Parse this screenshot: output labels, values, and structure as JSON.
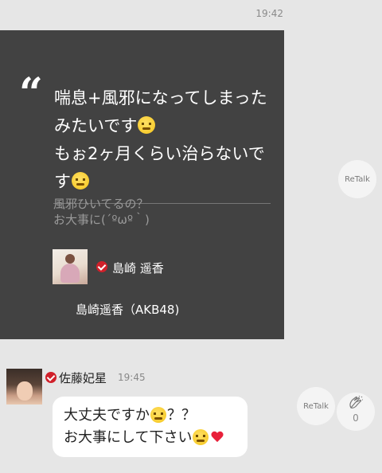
{
  "header": {
    "time": "19:42"
  },
  "quote_card": {
    "quote_mark": "“",
    "text_segments": [
      "喘息+風邪になってしまったみたいです",
      "もぉ2ヶ月くらい治らないです"
    ],
    "original_post_lines": [
      "風邪ひいてるの？",
      "お大事に(´ºωº｀)"
    ],
    "original_author": "島崎 遥香",
    "original_author_group": "島崎遥香（AKB48)",
    "retalk_label": "ReTalk"
  },
  "reply": {
    "author": "佐藤妃星",
    "time": "19:45",
    "lines": [
      "大丈夫ですか",
      "？？",
      "お大事にして下さい"
    ],
    "retalk_label": "ReTalk",
    "clap_count": "0"
  },
  "icons": {
    "quote": "quote-icon",
    "verified": "verified-badge-icon",
    "emoji": "grimacing-face-emoji",
    "heart": "heart-icon",
    "clap": "clapping-hands-icon"
  },
  "colors": {
    "background": "#e6e6e6",
    "card": "#424242",
    "verified": "#d0202a",
    "heart": "#e8203a"
  }
}
